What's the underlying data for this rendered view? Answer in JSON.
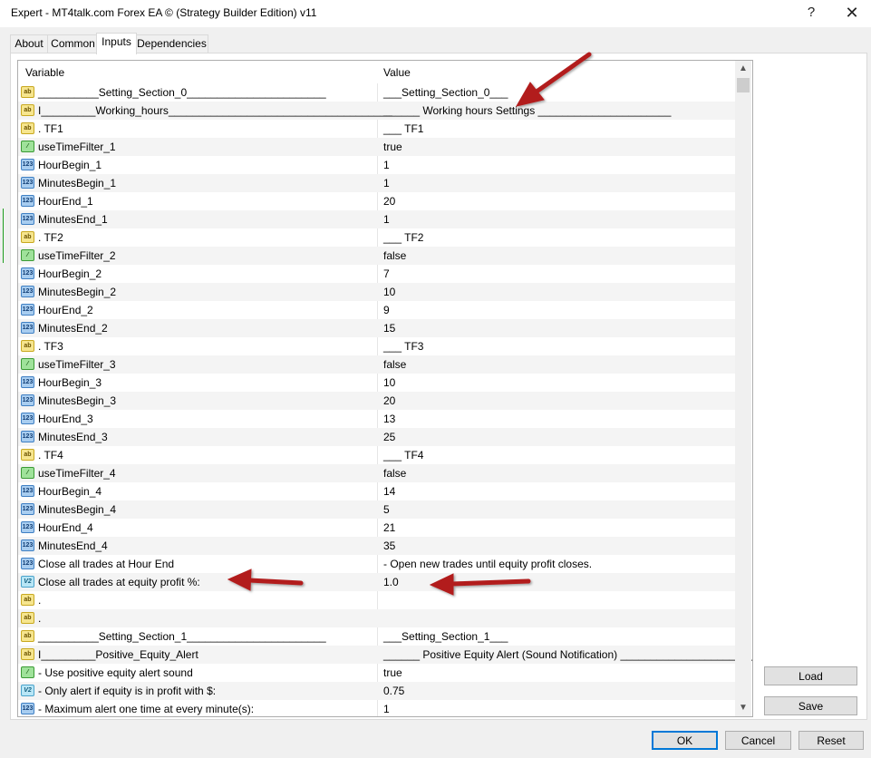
{
  "window": {
    "title": "Expert - MT4talk.com Forex EA © (Strategy Builder Edition) v11",
    "help_glyph": "?",
    "close_glyph": "✕"
  },
  "tabs": [
    "About",
    "Common",
    "Inputs",
    "Dependencies"
  ],
  "active_tab": "Inputs",
  "grid": {
    "columns": {
      "variable": "Variable",
      "value": "Value"
    },
    "rows": [
      {
        "type": "ab",
        "variable": "__________Setting_Section_0_______________________",
        "value": "___Setting_Section_0___"
      },
      {
        "type": "ab",
        "variable": "I_________Working_hours_____________________________________",
        "value": "______ Working hours Settings ______________________"
      },
      {
        "type": "ab",
        "variable": ". TF1",
        "value": "___ TF1"
      },
      {
        "type": "bool",
        "variable": "useTimeFilter_1",
        "value": "true"
      },
      {
        "type": "int",
        "variable": "HourBegin_1",
        "value": "1"
      },
      {
        "type": "int",
        "variable": "MinutesBegin_1",
        "value": "1"
      },
      {
        "type": "int",
        "variable": "HourEnd_1",
        "value": "20"
      },
      {
        "type": "int",
        "variable": "MinutesEnd_1",
        "value": "1"
      },
      {
        "type": "ab",
        "variable": ". TF2",
        "value": "___ TF2"
      },
      {
        "type": "bool",
        "variable": "useTimeFilter_2",
        "value": "false"
      },
      {
        "type": "int",
        "variable": "HourBegin_2",
        "value": "7"
      },
      {
        "type": "int",
        "variable": "MinutesBegin_2",
        "value": "10"
      },
      {
        "type": "int",
        "variable": "HourEnd_2",
        "value": "9"
      },
      {
        "type": "int",
        "variable": "MinutesEnd_2",
        "value": "15"
      },
      {
        "type": "ab",
        "variable": ". TF3",
        "value": "___ TF3"
      },
      {
        "type": "bool",
        "variable": "useTimeFilter_3",
        "value": "false"
      },
      {
        "type": "int",
        "variable": "HourBegin_3",
        "value": "10"
      },
      {
        "type": "int",
        "variable": "MinutesBegin_3",
        "value": "20"
      },
      {
        "type": "int",
        "variable": "HourEnd_3",
        "value": "13"
      },
      {
        "type": "int",
        "variable": "MinutesEnd_3",
        "value": "25"
      },
      {
        "type": "ab",
        "variable": ". TF4",
        "value": "___ TF4"
      },
      {
        "type": "bool",
        "variable": "useTimeFilter_4",
        "value": "false"
      },
      {
        "type": "int",
        "variable": "HourBegin_4",
        "value": "14"
      },
      {
        "type": "int",
        "variable": "MinutesBegin_4",
        "value": "5"
      },
      {
        "type": "int",
        "variable": "HourEnd_4",
        "value": "21"
      },
      {
        "type": "int",
        "variable": "MinutesEnd_4",
        "value": "35"
      },
      {
        "type": "int",
        "variable": "Close all trades at Hour End",
        "value": "- Open new trades until equity profit closes."
      },
      {
        "type": "dbl",
        "variable": "Close all trades at equity profit %:",
        "value": "1.0"
      },
      {
        "type": "ab",
        "variable": ".",
        "value": ""
      },
      {
        "type": "ab",
        "variable": ".",
        "value": ""
      },
      {
        "type": "ab",
        "variable": "__________Setting_Section_1_______________________",
        "value": "___Setting_Section_1___"
      },
      {
        "type": "ab",
        "variable": "I_________Positive_Equity_Alert",
        "value": "______ Positive Equity Alert (Sound Notification) _______________________"
      },
      {
        "type": "bool",
        "variable": "- Use positive equity alert sound",
        "value": "true"
      },
      {
        "type": "dbl",
        "variable": "- Only alert if equity is in profit with $:",
        "value": "0.75"
      },
      {
        "type": "int",
        "variable": "- Maximum alert one time at every minute(s):",
        "value": "1"
      }
    ]
  },
  "icons": {
    "ab": "ab",
    "bool": "⁄",
    "int": "123",
    "dbl": "V2"
  },
  "buttons": {
    "load": "Load",
    "save": "Save",
    "ok": "OK",
    "cancel": "Cancel",
    "reset": "Reset"
  },
  "colors": {
    "annotation_arrow": "#b21e1e",
    "default_button_border": "#0078d7"
  }
}
